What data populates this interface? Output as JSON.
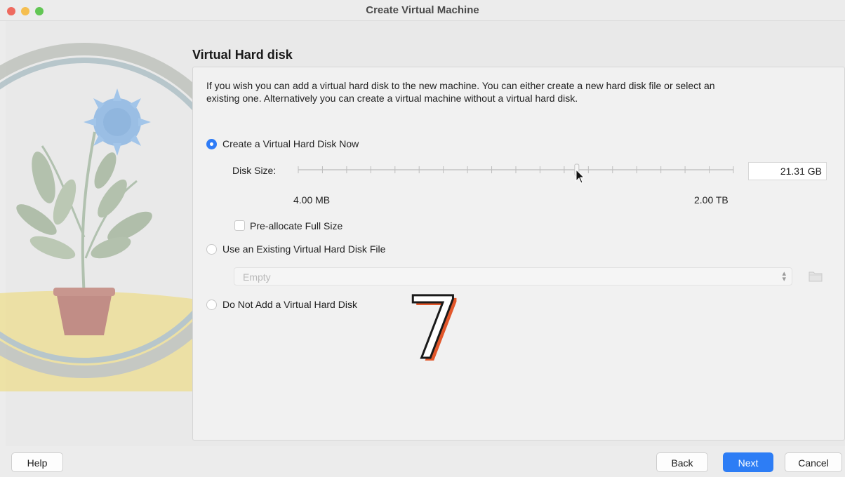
{
  "window": {
    "title": "Create Virtual Machine"
  },
  "page": {
    "heading": "Virtual Hard disk",
    "description": "If you wish you can add a virtual hard disk to the new machine. You can either create a new hard disk file or select an existing one. Alternatively you can create a virtual machine without a virtual hard disk."
  },
  "options": {
    "create_now": {
      "label": "Create a Virtual Hard Disk Now",
      "selected": true
    },
    "use_existing": {
      "label": "Use an Existing Virtual Hard Disk File",
      "selected": false
    },
    "do_not_add": {
      "label": "Do Not Add a Virtual Hard Disk",
      "selected": false
    }
  },
  "disk_size": {
    "label": "Disk Size:",
    "value": "21.31 GB",
    "min_label": "4.00 MB",
    "max_label": "2.00 TB",
    "slider_fraction": 0.64,
    "tick_count": 19
  },
  "preallocate": {
    "label": "Pre-allocate Full Size",
    "checked": false
  },
  "existing_file": {
    "value": "Empty",
    "arrow_icon": "updown-arrows-icon",
    "browse_icon": "folder-icon"
  },
  "overlay": {
    "step_number": "7"
  },
  "buttons": {
    "help": "Help",
    "back": "Back",
    "next": "Next",
    "cancel": "Cancel"
  },
  "colors": {
    "accent": "#2d7df5",
    "close": "#ee6a5f",
    "minimize": "#f5be4f",
    "maximize": "#62c654",
    "overlay_fill": "#ffffff",
    "overlay_shadow": "#e2572b"
  }
}
